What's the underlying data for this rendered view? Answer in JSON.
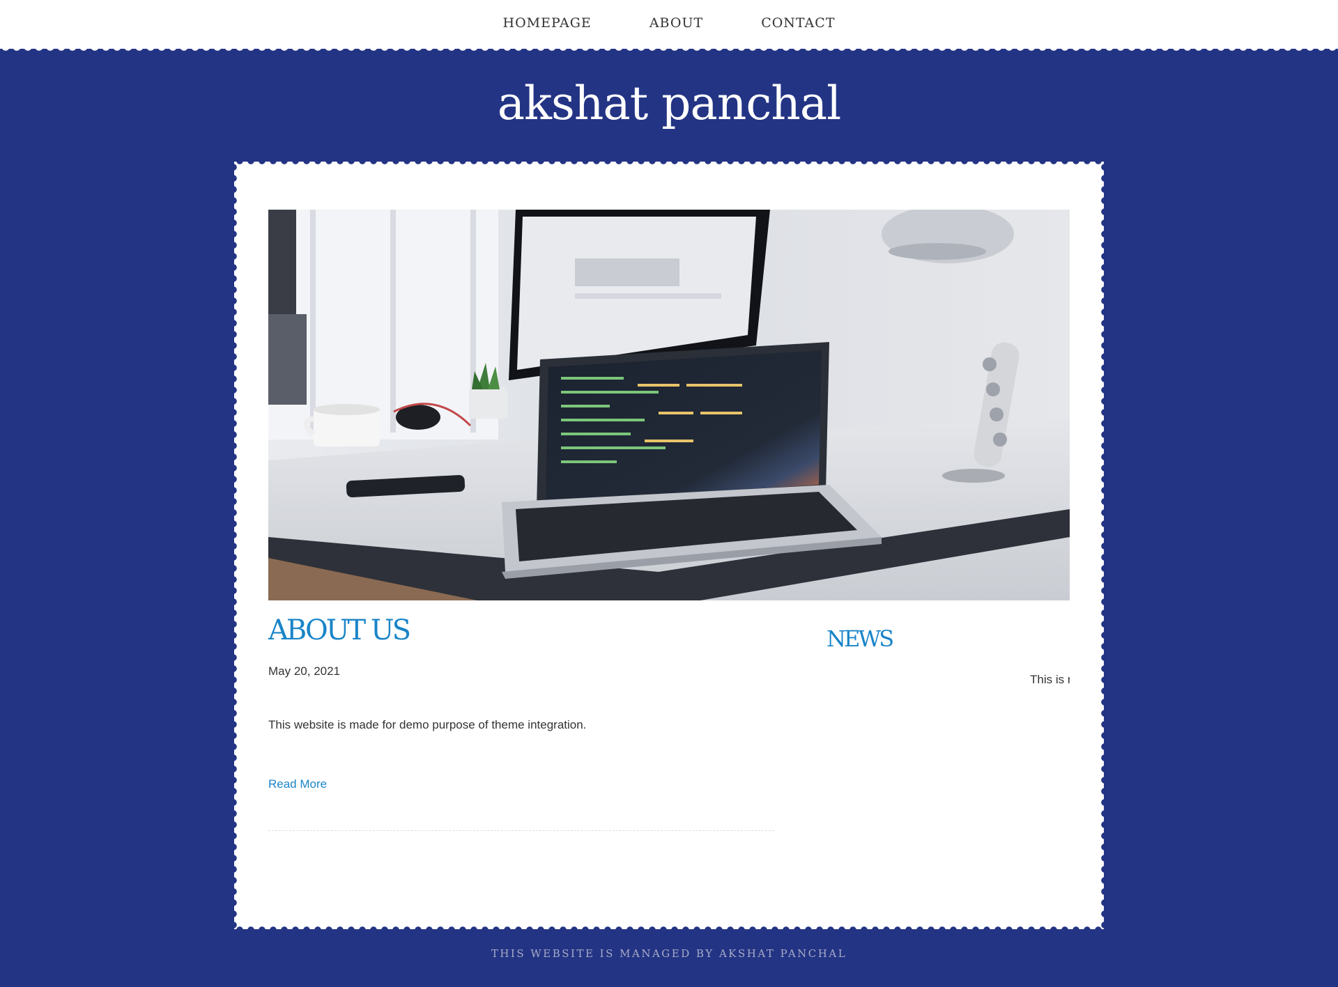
{
  "nav": {
    "items": [
      {
        "label": "HOMEPAGE"
      },
      {
        "label": "ABOUT"
      },
      {
        "label": "CONTACT"
      }
    ]
  },
  "site": {
    "title": "akshat panchal"
  },
  "hero": {
    "image": "desk-laptop-code-photo"
  },
  "about": {
    "title": "ABOUT US",
    "date": "May 20, 2021",
    "text": "This website is made for demo purpose of theme integration.",
    "read_more": "Read More"
  },
  "news": {
    "title": "NEWS",
    "ticker_text": "This is r"
  },
  "footer": {
    "text": "THIS WEBSITE IS MANAGED BY AKSHAT PANCHAL"
  },
  "colors": {
    "background": "#243484",
    "accent": "#1a84c8",
    "card": "#ffffff"
  }
}
